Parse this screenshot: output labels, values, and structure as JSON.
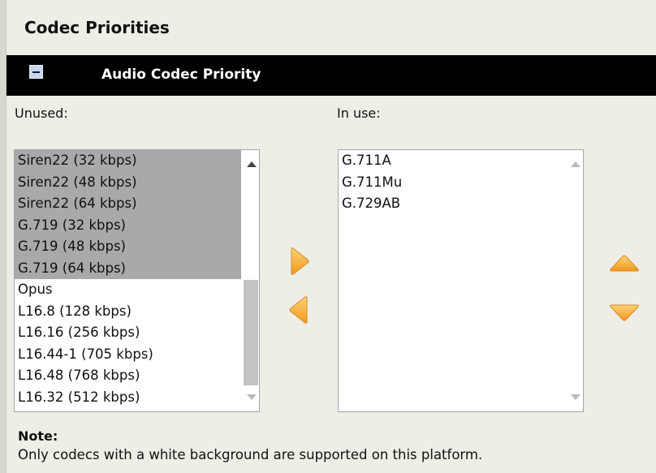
{
  "page": {
    "title": "Codec Priorities"
  },
  "section": {
    "title": "Audio Codec Priority",
    "collapse_icon": "minus-box-icon"
  },
  "unused": {
    "label": "Unused:",
    "items": [
      {
        "label": "Siren22 (32 kbps)",
        "supported": false
      },
      {
        "label": "Siren22 (48 kbps)",
        "supported": false
      },
      {
        "label": "Siren22 (64 kbps)",
        "supported": false
      },
      {
        "label": "G.719 (32 kbps)",
        "supported": false
      },
      {
        "label": "G.719 (48 kbps)",
        "supported": false
      },
      {
        "label": "G.719 (64 kbps)",
        "supported": false
      },
      {
        "label": "Opus",
        "supported": true
      },
      {
        "label": "L16.8 (128 kbps)",
        "supported": true
      },
      {
        "label": "L16.16 (256 kbps)",
        "supported": true
      },
      {
        "label": "L16.44-1 (705 kbps)",
        "supported": true
      },
      {
        "label": "L16.48 (768 kbps)",
        "supported": true
      },
      {
        "label": "L16.32 (512 kbps)",
        "supported": true
      }
    ]
  },
  "in_use": {
    "label": "In use:",
    "items": [
      {
        "label": "G.711A"
      },
      {
        "label": "G.711Mu"
      },
      {
        "label": "G.729AB"
      }
    ]
  },
  "controls": {
    "move_right_icon": "arrow-right-icon",
    "move_left_icon": "arrow-left-icon",
    "move_up_icon": "arrow-up-icon",
    "move_down_icon": "arrow-down-icon",
    "accent_color": "#f5a623"
  },
  "note": {
    "label": "Note:",
    "text": "Only codecs with a white background are supported on this platform."
  }
}
